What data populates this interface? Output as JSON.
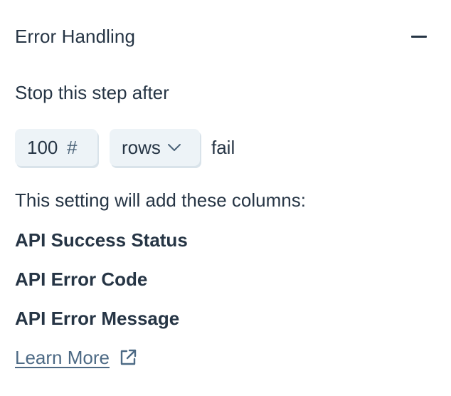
{
  "section": {
    "title": "Error Handling",
    "collapse_icon": "minus-icon"
  },
  "stop_setting": {
    "label": "Stop this step after",
    "count_value": "100",
    "count_icon_glyph": "#",
    "unit_selected": "rows",
    "suffix": "fail"
  },
  "columns_info": {
    "intro": "This setting will add these columns:",
    "columns": [
      "API Success Status",
      "API Error Code",
      "API Error Message"
    ]
  },
  "learn_more": {
    "label": "Learn More",
    "icon": "external-link-icon"
  },
  "colors": {
    "text": "#263545",
    "link": "#4d6a85",
    "input_bg": "#edf3f7"
  }
}
